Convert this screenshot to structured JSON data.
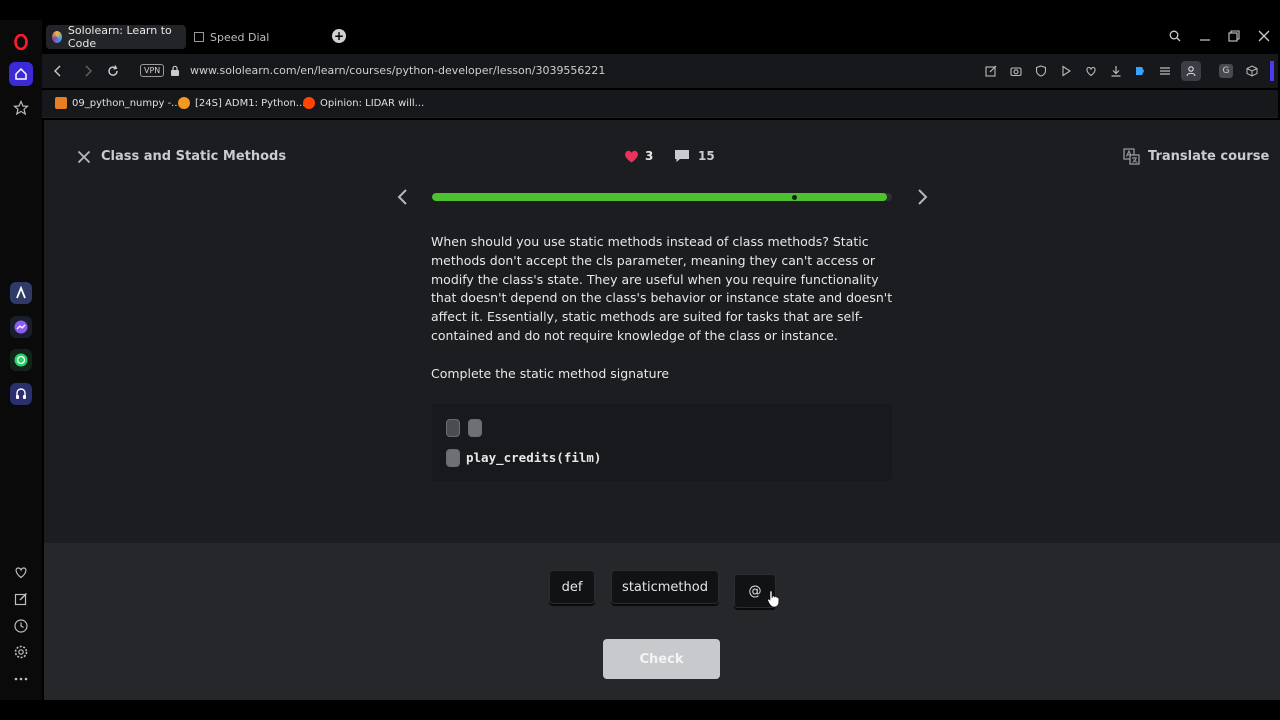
{
  "browser": {
    "tabs": [
      {
        "label": "Sololearn: Learn to Code",
        "active": true
      },
      {
        "label": "Speed Dial",
        "active": false
      }
    ],
    "url": "www.sololearn.com/en/learn/courses/python-developer/lesson/3039556221",
    "vpn_label": "VPN",
    "extension_g_label": "G",
    "bookmarks": [
      {
        "label": "09_python_numpy -..."
      },
      {
        "label": "[24S] ADM1: Python..."
      },
      {
        "label": "Opinion: LIDAR will..."
      }
    ]
  },
  "lesson": {
    "title": "Class and Static Methods",
    "hearts": "3",
    "comments": "15",
    "translate_label": "Translate course",
    "progress_fraction": 0.99,
    "body_text": "When should you use static methods instead of class methods? Static methods don't accept the cls parameter, meaning they can't access or modify the class's state. They are useful when you require functionality that doesn't depend on the class's behavior or instance state and doesn't affect it. Essentially, static methods are suited for tasks that are self-contained and do not require knowledge of the class or instance.",
    "prompt": "Complete the static method signature",
    "code_line": "play_credits(film)"
  },
  "answers": {
    "options": [
      "def",
      "staticmethod",
      "@"
    ],
    "check_label": "Check"
  },
  "colors": {
    "progress": "#4ec22e",
    "heart": "#e8315b",
    "background": "#1c1d20"
  }
}
